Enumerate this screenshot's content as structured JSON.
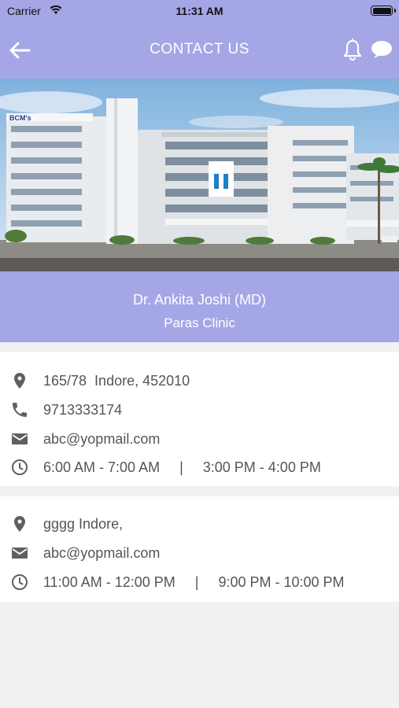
{
  "status_bar": {
    "carrier": "Carrier",
    "time": "11:31 AM"
  },
  "header": {
    "title": "CONTACT US",
    "icons": [
      "back-arrow-icon",
      "bell-icon",
      "chat-icon"
    ]
  },
  "hero": {
    "image": "hospital-building-photo"
  },
  "doctor": {
    "name": "Dr. Ankita Joshi (MD)",
    "clinic": "Paras Clinic"
  },
  "locations": [
    {
      "address": "165/78  Indore, 452010",
      "phone": "9713333174",
      "email": "abc@yopmail.com",
      "hours": "6:00 AM - 7:00 AM     |     3:00 PM - 4:00 PM"
    },
    {
      "address": "gggg Indore,",
      "email": "abc@yopmail.com",
      "hours": "11:00 AM - 12:00 PM     |     9:00 PM - 10:00 PM"
    }
  ],
  "colors": {
    "accent": "#a5a6e6",
    "background": "#f1f1f1",
    "card": "#ffffff",
    "text": "#555555"
  }
}
